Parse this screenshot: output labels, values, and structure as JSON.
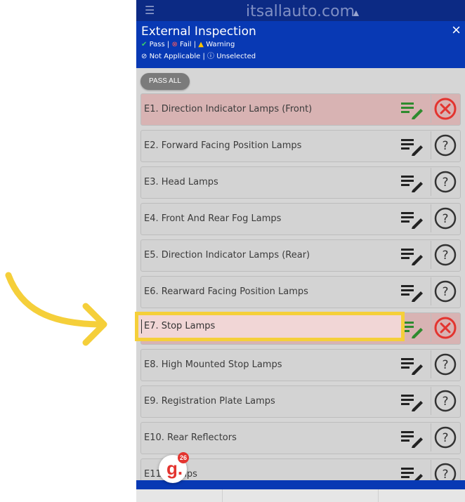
{
  "topbar": {
    "brand": "itsallauto.com"
  },
  "header": {
    "title": "External Inspection",
    "close": "×",
    "legend_line1": {
      "pass": "Pass |",
      "fail": "Fail |",
      "warning": "Warning"
    },
    "legend_line2": {
      "na": "Not Applicable |",
      "unselected": "Unselected"
    }
  },
  "toolbar": {
    "pass_all": "PASS ALL"
  },
  "items": [
    {
      "label": "E1. Direction Indicator Lamps (Front)",
      "status": "fail"
    },
    {
      "label": "E2. Forward Facing Position Lamps",
      "status": "unselected"
    },
    {
      "label": "E3. Head Lamps",
      "status": "unselected"
    },
    {
      "label": "E4. Front And Rear Fog Lamps",
      "status": "unselected"
    },
    {
      "label": "E5. Direction Indicator Lamps (Rear)",
      "status": "unselected"
    },
    {
      "label": "E6. Rearward Facing Position Lamps",
      "status": "unselected"
    },
    {
      "label": "E7. Stop Lamps",
      "status": "fail"
    },
    {
      "label": "E8. High Mounted Stop Lamps",
      "status": "unselected"
    },
    {
      "label": "E9. Registration Plate Lamps",
      "status": "unselected"
    },
    {
      "label": "E10. Rear Reflectors",
      "status": "unselected"
    },
    {
      "label": "E11. Lamps",
      "status": "unselected"
    }
  ],
  "badge": {
    "letter": "g.",
    "count": "26"
  },
  "colors": {
    "brand_blue": "#0839b4",
    "fail_red": "#e3342f",
    "highlight_yellow": "#f5cf3a",
    "note_green": "#2e8b2e"
  }
}
